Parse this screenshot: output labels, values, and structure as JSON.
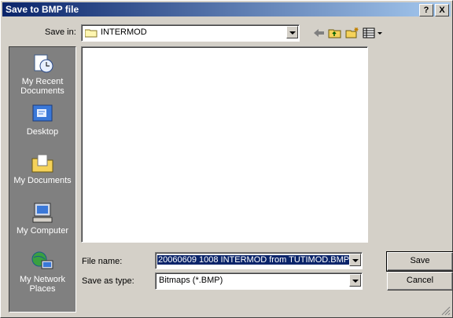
{
  "window": {
    "title": "Save to BMP file",
    "help_label": "?",
    "close_label": "X"
  },
  "toolbar": {
    "save_in_label": "Save in:",
    "save_in_value": "INTERMOD",
    "icons": [
      "back-arrow-icon",
      "up-folder-icon",
      "new-folder-icon",
      "view-menu-icon"
    ]
  },
  "places": [
    {
      "label_line1": "My Recent",
      "label_line2": "Documents",
      "icon": "recent-documents-icon"
    },
    {
      "label_line1": "Desktop",
      "label_line2": "",
      "icon": "desktop-icon"
    },
    {
      "label_line1": "My Documents",
      "label_line2": "",
      "icon": "my-documents-icon"
    },
    {
      "label_line1": "My Computer",
      "label_line2": "",
      "icon": "my-computer-icon"
    },
    {
      "label_line1": "My Network",
      "label_line2": "Places",
      "icon": "network-places-icon"
    }
  ],
  "form": {
    "file_name_label": "File name:",
    "file_name_value": "20060609 1008 INTERMOD from TUTIMOD.BMP",
    "save_as_type_label": "Save as type:",
    "save_as_type_value": "Bitmaps (*.BMP)"
  },
  "buttons": {
    "save": "Save",
    "cancel": "Cancel"
  },
  "colors": {
    "titlebar_start": "#0a246a",
    "titlebar_end": "#a6caf0",
    "dialog_bg": "#d4d0c8",
    "places_bg": "#808080"
  }
}
